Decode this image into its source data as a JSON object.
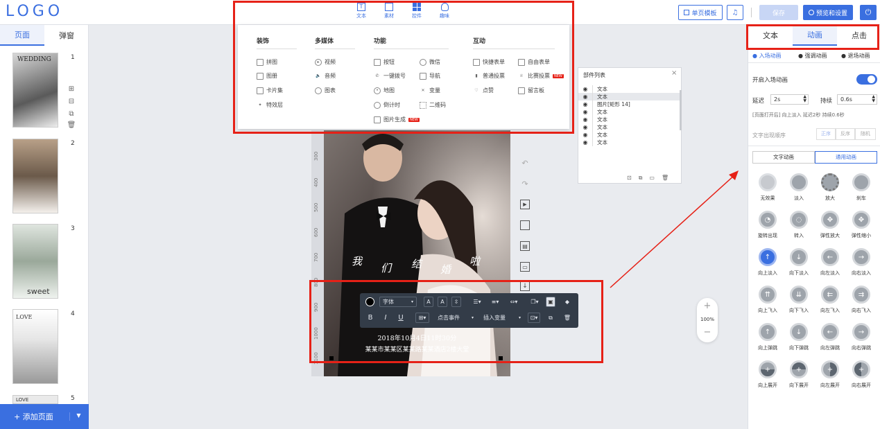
{
  "topbar": {
    "logo": "LOGO",
    "template_button": "单页模板",
    "save_button": "保存",
    "preview_button": "预览和设置",
    "insert_tabs": [
      {
        "label": "文本",
        "icon": "text-icon"
      },
      {
        "label": "素材",
        "icon": "image-icon"
      },
      {
        "label": "控件",
        "icon": "widget-icon"
      },
      {
        "label": "趣味",
        "icon": "lightbulb-icon"
      }
    ]
  },
  "left_sidebar": {
    "tabs": [
      "页面",
      "弹窗"
    ],
    "pages": [
      {
        "num": "1",
        "caption": "WEDDING"
      },
      {
        "num": "2",
        "caption": ""
      },
      {
        "num": "3",
        "caption": "sweet"
      },
      {
        "num": "4",
        "caption": "LOVE"
      },
      {
        "num": "5",
        "caption": "LOVE"
      }
    ],
    "add_page": "+ 添加页面"
  },
  "dropdown": {
    "columns": [
      {
        "title": "装饰",
        "items": [
          "拼图",
          "图册",
          "卡片集",
          "特效层"
        ]
      },
      {
        "title": "多媒体",
        "items": [
          "视频",
          "音频",
          "图表"
        ]
      },
      {
        "title": "功能",
        "items": [
          "按钮",
          "微信",
          "一键拨号",
          "导航",
          "地图",
          "变量",
          "倒计时",
          "二维码",
          "图片生成"
        ]
      },
      {
        "title": "互动",
        "items": [
          "快捷表单",
          "自由表单",
          "普通投票",
          "比赛投票",
          "点赞",
          "留言板"
        ]
      }
    ],
    "new_badge": "NEW"
  },
  "layers": {
    "title": "部件列表",
    "rows": [
      "文本",
      "文本",
      "图片[矩形 14]",
      "文本",
      "文本",
      "文本",
      "文本",
      "文本"
    ]
  },
  "canvas": {
    "ruler_labels": [
      "300",
      "400",
      "500",
      "600",
      "700",
      "800",
      "900",
      "1000",
      "1100"
    ],
    "poem": [
      "我",
      "们",
      "结",
      "婚",
      "啦"
    ],
    "date_text": "2018年10月4日11时30分",
    "address_text": "某某市某某区某某路某某酒店2楼大堂",
    "zoom": "100%"
  },
  "format_toolbar": {
    "font_label": "字体",
    "click_event": "点击事件",
    "insert_var": "插入变量"
  },
  "right_panel": {
    "tabs": [
      "文本",
      "动画",
      "点击"
    ],
    "subtabs": [
      "入场动画",
      "强调动画",
      "退场动画"
    ],
    "enable_label": "开启入场动画",
    "delay_label": "延迟",
    "delay_value": "2s",
    "duration_label": "持续",
    "duration_value": "0.6s",
    "summary": "[页面打开后] 向上淡入 延迟2秒 持续0.6秒",
    "order_label": "文字出现顺序",
    "order_options": [
      "正序",
      "反序",
      "随机"
    ],
    "anim_type_tabs": [
      "文字动画",
      "通用动画"
    ],
    "animations": [
      "无效果",
      "淡入",
      "放大",
      "刹车",
      "旋转出现",
      "转入",
      "弹性放大",
      "弹性缩小",
      "向上淡入",
      "向下淡入",
      "向左淡入",
      "向右淡入",
      "向上飞入",
      "向下飞入",
      "向左飞入",
      "向右飞入",
      "向上弹跳",
      "向下弹跳",
      "向左弹跳",
      "向右弹跳",
      "向上展开",
      "向下展开",
      "向左展开",
      "向右展开"
    ],
    "accent_color": "#3a6fe0"
  },
  "highlight_color": "#e62117"
}
